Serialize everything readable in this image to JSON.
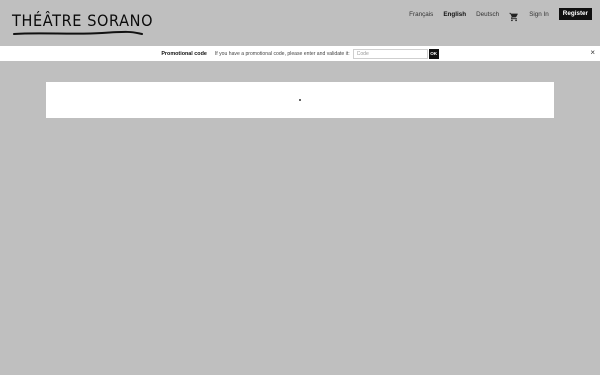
{
  "header": {
    "logo_text": "THÉÂTRE SORANO",
    "languages": [
      "Français",
      "English",
      "Deutsch"
    ],
    "active_language": "English",
    "cart_icon": "cart-icon",
    "sign_in_label": "Sign In",
    "register_label": "Register"
  },
  "promo": {
    "title": "Promotional code",
    "description": "If you have a promotional code, please enter and validate it:",
    "input_placeholder": "Code",
    "input_value": "",
    "ok_label": "OK",
    "close_symbol": "×"
  },
  "colors": {
    "background": "#bfbfbf",
    "panel": "#ffffff",
    "button_dark": "#111111"
  }
}
